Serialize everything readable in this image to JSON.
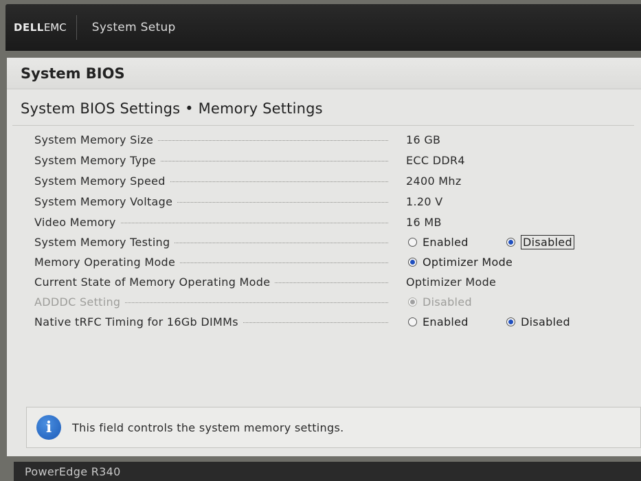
{
  "header": {
    "brand_primary": "DELL",
    "brand_secondary": "EMC",
    "title": "System Setup"
  },
  "panel": {
    "title": "System BIOS",
    "breadcrumb": "System BIOS Settings • Memory Settings"
  },
  "settings": [
    {
      "label": "System Memory Size",
      "value": "16 GB"
    },
    {
      "label": "System Memory Type",
      "value": "ECC DDR4"
    },
    {
      "label": "System Memory Speed",
      "value": "2400 Mhz"
    },
    {
      "label": "System Memory Voltage",
      "value": "1.20 V"
    },
    {
      "label": "Video Memory",
      "value": "16 MB"
    },
    {
      "label": "System Memory Testing",
      "options": [
        "Enabled",
        "Disabled"
      ],
      "selected": "Disabled"
    },
    {
      "label": "Memory Operating Mode",
      "options": [
        "Optimizer Mode"
      ],
      "selected": "Optimizer Mode"
    },
    {
      "label": "Current State of Memory Operating Mode",
      "value": "Optimizer Mode"
    },
    {
      "label": "ADDDC Setting",
      "options": [
        "Disabled"
      ],
      "selected": "Disabled",
      "disabled": true
    },
    {
      "label": "Native tRFC Timing for 16Gb DIMMs",
      "options": [
        "Enabled",
        "Disabled"
      ],
      "selected": "Disabled"
    }
  ],
  "help": {
    "icon": "info-icon",
    "text": "This field controls the system memory settings."
  },
  "footer": {
    "model": "PowerEdge R340"
  },
  "colors": {
    "header_bg": "#1a1a1a",
    "panel_bg": "#e6e6e4",
    "radio_selected": "#1f4fbf",
    "info_icon": "#1d5bb8"
  }
}
